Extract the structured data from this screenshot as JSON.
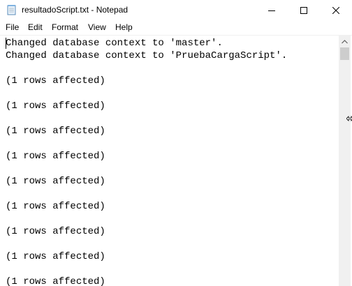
{
  "window": {
    "title": "resultadoScript.txt - Notepad",
    "app_icon": "notepad-icon"
  },
  "caption_buttons": {
    "minimize_icon": "minimize-icon",
    "maximize_icon": "maximize-icon",
    "close_icon": "close-icon"
  },
  "menu": {
    "items": [
      "File",
      "Edit",
      "Format",
      "View",
      "Help"
    ]
  },
  "document": {
    "lines": [
      "Changed database context to 'master'.",
      "Changed database context to 'PruebaCargaScript'.",
      "",
      "(1 rows affected)",
      "",
      "(1 rows affected)",
      "",
      "(1 rows affected)",
      "",
      "(1 rows affected)",
      "",
      "(1 rows affected)",
      "",
      "(1 rows affected)",
      "",
      "(1 rows affected)",
      "",
      "(1 rows affected)",
      "",
      "(1 rows affected)"
    ]
  },
  "colors": {
    "text": "#000000",
    "background": "#ffffff",
    "scrollbar_track": "#f0f0f0",
    "scrollbar_thumb": "#cdcdcd"
  }
}
